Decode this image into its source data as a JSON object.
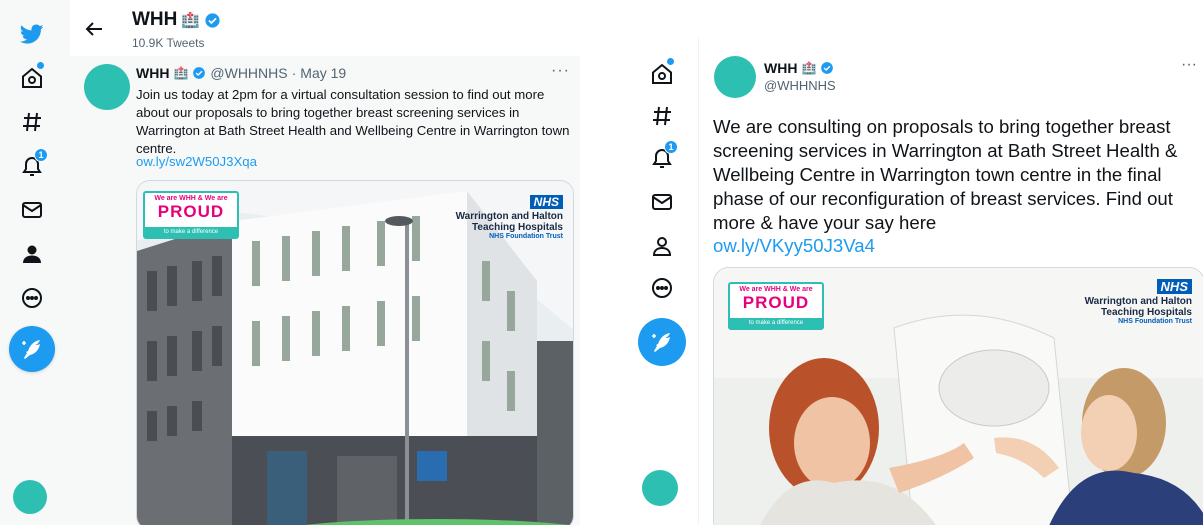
{
  "left_panel": {
    "header": {
      "name": "WHH",
      "tweet_count": "10.9K Tweets"
    },
    "nav": {
      "notifications_count": "1"
    },
    "tweet": {
      "name": "WHH",
      "handle": "@WHHNHS",
      "separator": "·",
      "date": "May 19",
      "more": "···",
      "text": "Join us today at 2pm for a virtual consultation session to find out more about our proposals to bring together breast screening services in Warrington at Bath Street Health and Wellbeing Centre in Warrington town centre.",
      "link": "ow.ly/sw2W50J3Xqa"
    }
  },
  "right_panel": {
    "nav": {
      "notifications_count": "1"
    },
    "tweet": {
      "name": "WHH",
      "handle": "@WHHNHS",
      "more": "···",
      "text": "We are consulting on proposals to bring together breast screening services in Warrington at Bath Street Health & Wellbeing Centre in Warrington town centre in the final phase of our reconfiguration of breast services. Find out more & have your say here",
      "link": "ow.ly/VKyy50J3Va4"
    }
  },
  "image_overlay": {
    "proud_top": "We are WHH & We are",
    "proud_word": "PROUD",
    "proud_bottom": "to make a difference",
    "nhs": "NHS",
    "trust_name_1": "Warrington and Halton",
    "trust_name_2": "Teaching Hospitals",
    "trust_sub": "NHS Foundation Trust"
  },
  "colors": {
    "accent": "#1d9bf0",
    "brand_teal": "#2ebfb3",
    "nhs_blue": "#005eb8",
    "proud_pink": "#e6007e"
  },
  "icons": [
    "twitter-bird-icon",
    "home-icon",
    "explore-hash-icon",
    "notifications-bell-icon",
    "messages-envelope-icon",
    "profile-icon",
    "more-circle-icon",
    "compose-tweet-icon",
    "back-arrow-icon",
    "verified-badge-icon",
    "hospital-emoji-icon"
  ]
}
